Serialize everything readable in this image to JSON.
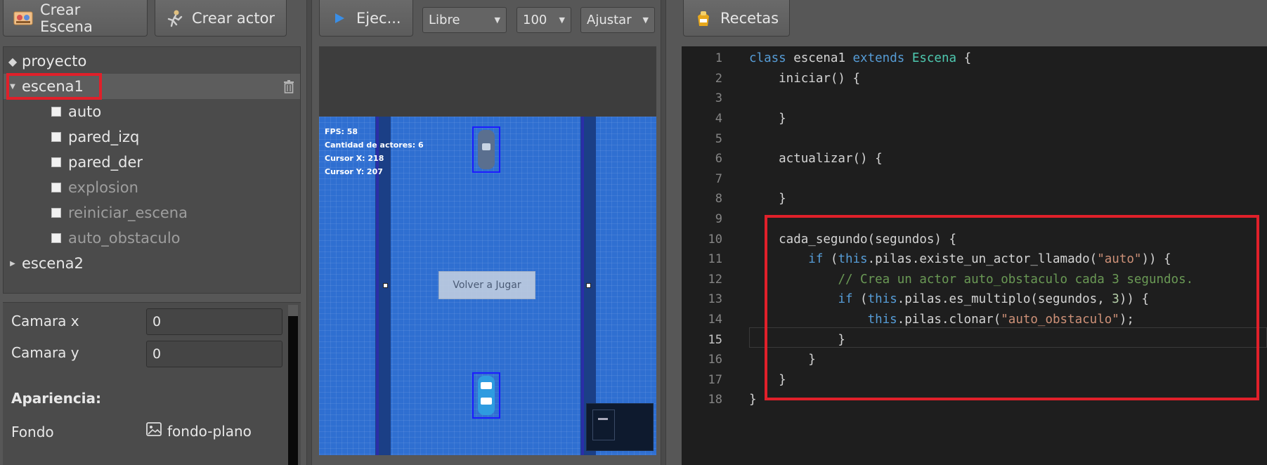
{
  "toolbar": {
    "crear_escena": "Crear Escena",
    "crear_actor": "Crear actor",
    "ejecutar": "Ejec...",
    "modo": "Libre",
    "zoom": "100",
    "ajuste": "Ajustar",
    "recetas": "Recetas"
  },
  "tree": {
    "project": "proyecto",
    "scene1": "escena1",
    "actors": [
      {
        "name": "auto",
        "enabled": true
      },
      {
        "name": "pared_izq",
        "enabled": true
      },
      {
        "name": "pared_der",
        "enabled": true
      },
      {
        "name": "explosion",
        "enabled": false
      },
      {
        "name": "reiniciar_escena",
        "enabled": false
      },
      {
        "name": "auto_obstaculo",
        "enabled": false
      }
    ],
    "scene2": "escena2"
  },
  "props": {
    "camara_x_label": "Camara x",
    "camara_x": "0",
    "camara_y_label": "Camara y",
    "camara_y": "0",
    "apariencia": "Apariencia:",
    "fondo_label": "Fondo",
    "fondo": "fondo-plano"
  },
  "game": {
    "fps": "FPS: 58",
    "actores": "Cantidad de actores: 6",
    "cursor_x": "Cursor X: 218",
    "cursor_y": "Cursor Y: 207",
    "boton": "Volver a Jugar"
  },
  "editor": {
    "current_line": 15,
    "lines": [
      "1",
      "2",
      "3",
      "4",
      "5",
      "6",
      "7",
      "8",
      "9",
      "10",
      "11",
      "12",
      "13",
      "14",
      "15",
      "16",
      "17",
      "18"
    ]
  },
  "colors": {
    "highlight_box": "#e0202a",
    "game_bg": "#2f6fd1",
    "editor_bg": "#1e1e1e"
  }
}
